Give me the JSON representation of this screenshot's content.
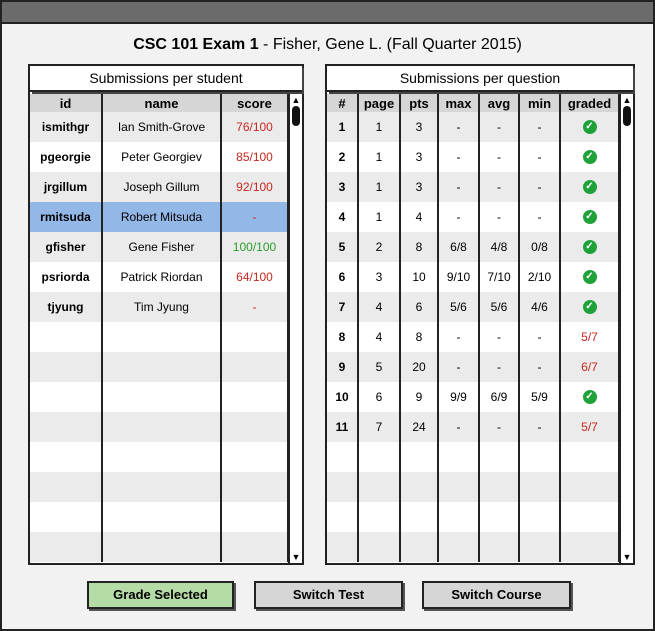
{
  "header": {
    "course_exam": "CSC 101 Exam 1",
    "student_term": " - Fisher, Gene L. (Fall Quarter 2015)"
  },
  "students_panel": {
    "title": "Submissions per student",
    "columns": [
      "id",
      "name",
      "score"
    ],
    "rows": [
      {
        "id": "ismithgr",
        "name": "Ian Smith-Grove",
        "score": "76/100",
        "score_color": "red"
      },
      {
        "id": "pgeorgie",
        "name": "Peter Georgiev",
        "score": "85/100",
        "score_color": "red"
      },
      {
        "id": "jrgillum",
        "name": "Joseph Gillum",
        "score": "92/100",
        "score_color": "red"
      },
      {
        "id": "rmitsuda",
        "name": "Robert Mitsuda",
        "score": "-",
        "score_color": "red",
        "selected": true
      },
      {
        "id": "gfisher",
        "name": "Gene Fisher",
        "score": "100/100",
        "score_color": "green"
      },
      {
        "id": "psriorda",
        "name": "Patrick Riordan",
        "score": "64/100",
        "score_color": "red"
      },
      {
        "id": "tjyung",
        "name": "Tim Jyung",
        "score": "-",
        "score_color": "red"
      }
    ]
  },
  "questions_panel": {
    "title": "Submissions per question",
    "columns": [
      "#",
      "page",
      "pts",
      "max",
      "avg",
      "min",
      "graded"
    ],
    "rows": [
      {
        "num": "1",
        "page": "1",
        "pts": "3",
        "max": "-",
        "avg": "-",
        "min": "-",
        "graded": "check"
      },
      {
        "num": "2",
        "page": "1",
        "pts": "3",
        "max": "-",
        "avg": "-",
        "min": "-",
        "graded": "check"
      },
      {
        "num": "3",
        "page": "1",
        "pts": "3",
        "max": "-",
        "avg": "-",
        "min": "-",
        "graded": "check"
      },
      {
        "num": "4",
        "page": "1",
        "pts": "4",
        "max": "-",
        "avg": "-",
        "min": "-",
        "graded": "check"
      },
      {
        "num": "5",
        "page": "2",
        "pts": "8",
        "max": "6/8",
        "avg": "4/8",
        "min": "0/8",
        "graded": "check"
      },
      {
        "num": "6",
        "page": "3",
        "pts": "10",
        "max": "9/10",
        "avg": "7/10",
        "min": "2/10",
        "graded": "check"
      },
      {
        "num": "7",
        "page": "4",
        "pts": "6",
        "max": "5/6",
        "avg": "5/6",
        "min": "4/6",
        "graded": "check"
      },
      {
        "num": "8",
        "page": "4",
        "pts": "8",
        "max": "-",
        "avg": "-",
        "min": "-",
        "graded": "5/7"
      },
      {
        "num": "9",
        "page": "5",
        "pts": "20",
        "max": "-",
        "avg": "-",
        "min": "-",
        "graded": "6/7"
      },
      {
        "num": "10",
        "page": "6",
        "pts": "9",
        "max": "9/9",
        "avg": "6/9",
        "min": "5/9",
        "graded": "check"
      },
      {
        "num": "11",
        "page": "7",
        "pts": "24",
        "max": "-",
        "avg": "-",
        "min": "-",
        "graded": "5/7"
      }
    ]
  },
  "buttons": {
    "grade_selected": "Grade Selected",
    "switch_test": "Switch Test",
    "switch_course": "Switch Course"
  },
  "icons": {
    "check": "check-circle-icon",
    "scroll_up": "arrow-up-icon",
    "scroll_down": "arrow-down-icon"
  },
  "colors": {
    "selected_row": "#93b8e8",
    "grade_button": "#b5dca6",
    "incomplete": "#c8281e",
    "complete": "#2aa02a"
  }
}
